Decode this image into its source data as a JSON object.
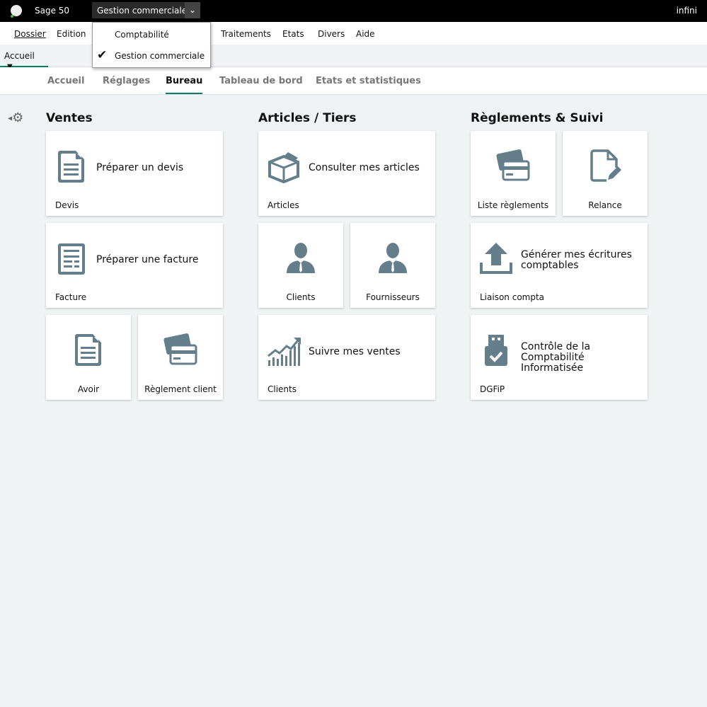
{
  "titlebar": {
    "app": "Sage 50",
    "module": "Gestion commerciale",
    "user": "infini"
  },
  "menu": [
    "Dossier",
    "Edition",
    "Traitements",
    "Etats",
    "Divers",
    "Aide"
  ],
  "module_menu": {
    "items": [
      "Comptabilité",
      "Gestion commerciale"
    ],
    "checked": "Gestion commerciale"
  },
  "nav": {
    "home": "Accueil"
  },
  "tabs": [
    "Accueil",
    "Réglages",
    "Bureau",
    "Tableau de bord",
    "Etats et statistiques"
  ],
  "active_tab": "Bureau",
  "sections": [
    "Ventes",
    "Articles / Tiers",
    "Règlements & Suivi"
  ],
  "tiles": [
    {
      "title": "Préparer un devis",
      "label": "Devis",
      "icon": "document-icon"
    },
    {
      "title": "Préparer une facture",
      "label": "Facture",
      "icon": "invoice-icon"
    },
    {
      "label": "Avoir",
      "icon": "document-icon"
    },
    {
      "label": "Règlement client",
      "icon": "payment-cards-icon"
    },
    {
      "title": "Consulter mes articles",
      "label": "Articles",
      "icon": "box-icon"
    },
    {
      "label": "Clients",
      "icon": "person-icon"
    },
    {
      "label": "Fournisseurs",
      "icon": "person-icon"
    },
    {
      "title": "Suivre mes ventes",
      "label": "Clients",
      "icon": "growth-chart-icon"
    },
    {
      "label": "Liste règlements",
      "icon": "payment-cards-icon"
    },
    {
      "label": "Relance",
      "icon": "document-edit-icon"
    },
    {
      "title": "Générer mes écritures comptables",
      "label": "Liaison compta",
      "icon": "upload-icon"
    },
    {
      "title": "Contrôle de la Comptabilité Informatisée",
      "label": "DGFiP",
      "icon": "usb-check-icon"
    }
  ],
  "colors": {
    "accent": "#008060",
    "icon": "#647f8b"
  }
}
